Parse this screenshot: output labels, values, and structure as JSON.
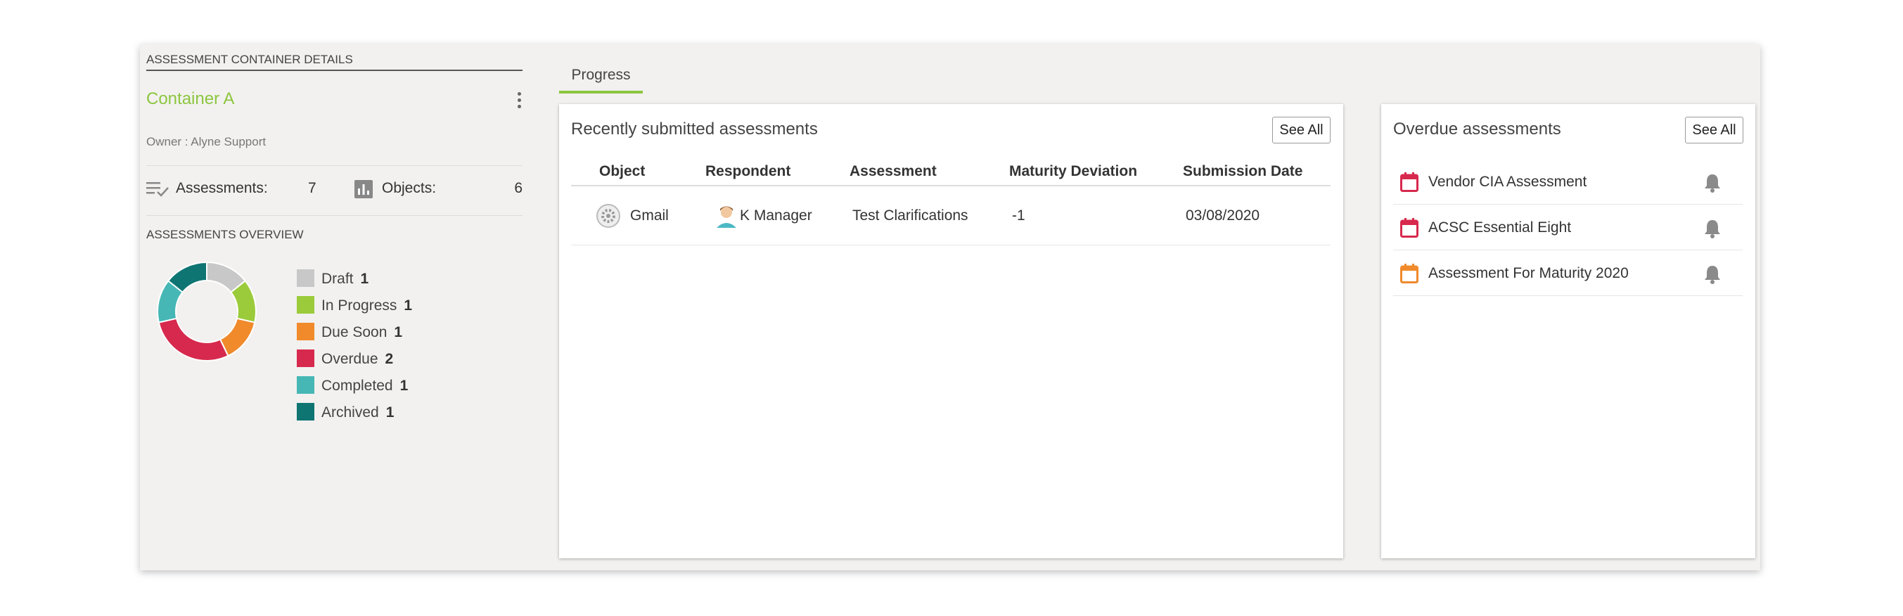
{
  "left_panel": {
    "section_title": "ASSESSMENT CONTAINER DETAILS",
    "container_name": "Container A",
    "owner": "Owner : Alyne Support",
    "assessments_label": "Assessments:",
    "assessments_count": "7",
    "objects_label": "Objects:",
    "objects_count": "6",
    "overview_title": "ASSESSMENTS OVERVIEW",
    "legend": [
      {
        "label": "Draft",
        "count": "1",
        "color": "#c8c8c8"
      },
      {
        "label": "In Progress",
        "count": "1",
        "color": "#9bcb3b"
      },
      {
        "label": "Due Soon",
        "count": "1",
        "color": "#f08a2b"
      },
      {
        "label": "Overdue",
        "count": "2",
        "color": "#d7294d"
      },
      {
        "label": "Completed",
        "count": "1",
        "color": "#46b7b5"
      },
      {
        "label": "Archived",
        "count": "1",
        "color": "#0e7573"
      }
    ]
  },
  "tabs": [
    {
      "label": "Progress",
      "active": true
    }
  ],
  "recent": {
    "title": "Recently submitted assessments",
    "see_all": "See All",
    "columns": [
      "Object",
      "Respondent",
      "Assessment",
      "Maturity Deviation",
      "Submission Date"
    ],
    "rows": [
      {
        "object": "Gmail",
        "respondent": "K Manager",
        "assessment": "Test Clarifications",
        "deviation": "-1",
        "date": "03/08/2020"
      }
    ]
  },
  "overdue": {
    "title": "Overdue assessments",
    "see_all": "See All",
    "items": [
      {
        "label": "Vendor CIA Assessment",
        "color": "#d7294d"
      },
      {
        "label": "ACSC Essential Eight",
        "color": "#d7294d"
      },
      {
        "label": "Assessment For Maturity 2020",
        "color": "#f08a2b"
      }
    ]
  },
  "colors": {
    "accent": "#8cc63f",
    "icon_gray": "#888888"
  }
}
